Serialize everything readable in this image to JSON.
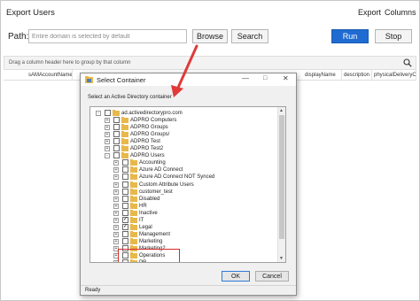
{
  "header": {
    "title": "Export Users",
    "export_label": "Export",
    "columns_label": "Columns"
  },
  "path_row": {
    "label": "Path:",
    "placeholder": "Entire domain is selected by default",
    "browse_label": "Browse",
    "search_label": "Search",
    "run_label": "Run",
    "stop_label": "Stop"
  },
  "grid": {
    "group_hint": "Drag a column header here to group by that column",
    "columns": [
      "sAMAccountName",
      "displayName",
      "description",
      "physicalDeliveryOfficeName"
    ]
  },
  "dialog": {
    "title": "Select Container",
    "instruction": "Select an Active Directory container",
    "ok_label": "OK",
    "cancel_label": "Cancel",
    "status": "Ready",
    "tree": [
      {
        "label": "ad.activedirectorypro.com",
        "expander": "-",
        "checked": false
      },
      {
        "label": "ADPRO Computers",
        "expander": "+",
        "checked": false
      },
      {
        "label": "ADPRO Groups",
        "expander": "+",
        "checked": false
      },
      {
        "label": "ADPRO Groups/",
        "expander": "+",
        "checked": false
      },
      {
        "label": "ADPRO Test",
        "expander": "+",
        "checked": false
      },
      {
        "label": "ADPRO Test2",
        "expander": "+",
        "checked": false
      },
      {
        "label": "ADPRO Users",
        "expander": "-",
        "checked": false
      },
      {
        "label": "Accounting",
        "expander": "+",
        "checked": false
      },
      {
        "label": "Azure AD Connect",
        "expander": "+",
        "checked": false
      },
      {
        "label": "Azure AD Connect NOT Synced",
        "expander": "+",
        "checked": false
      },
      {
        "label": "Custom Attribute Users",
        "expander": "+",
        "checked": false
      },
      {
        "label": "customer_test",
        "expander": "+",
        "checked": false
      },
      {
        "label": "Disabled",
        "expander": "+",
        "checked": false
      },
      {
        "label": "HR",
        "expander": "+",
        "checked": false
      },
      {
        "label": "Inactive",
        "expander": "+",
        "checked": false
      },
      {
        "label": "IT",
        "expander": "+",
        "checked": true
      },
      {
        "label": "Legal",
        "expander": "+",
        "checked": true
      },
      {
        "label": "Management",
        "expander": "+",
        "checked": false
      },
      {
        "label": "Marketing",
        "expander": "+",
        "checked": false
      },
      {
        "label": "Marketing2",
        "expander": "+",
        "checked": false
      },
      {
        "label": "Operations",
        "expander": "+",
        "checked": false
      },
      {
        "label": "PR",
        "expander": "+",
        "checked": false
      }
    ]
  },
  "colors": {
    "accent": "#1f6bd1",
    "highlight": "#d42b2b",
    "folder": "#e8b84a"
  },
  "icons": [
    "search-icon",
    "dialog-app-icon",
    "folder-icon",
    "red-arrow"
  ]
}
